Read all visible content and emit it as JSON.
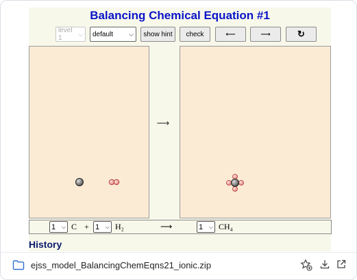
{
  "sim": {
    "title": "Balancing Chemical Equation #1",
    "controls": {
      "level_select": "level 1",
      "mode_select": "default",
      "hint_label": "show hint",
      "check_label": "check",
      "prev_label": "⟵",
      "next_label": "⟶",
      "reset_label": "↻"
    },
    "reaction_arrow": "⟶",
    "equation": {
      "coef1": "1",
      "term1": "C",
      "plus": "+",
      "coef2": "1",
      "term2": "H₂",
      "arrow": "⟶",
      "coef3": "1",
      "term3": "CH₄"
    },
    "history_heading": "History"
  },
  "download": {
    "filename": "ejss_model_BalancingChemEqns21_ionic.zip",
    "icons": [
      "folder-icon",
      "star-add-icon",
      "download-icon",
      "open-external-icon"
    ]
  },
  "colors": {
    "title": "#0a14c8",
    "panel_bg": "#fbebd5",
    "sim_bg": "#f7f8ea",
    "carbon_atom": "#777777",
    "hydrogen_atom": "#f4a6a0"
  }
}
